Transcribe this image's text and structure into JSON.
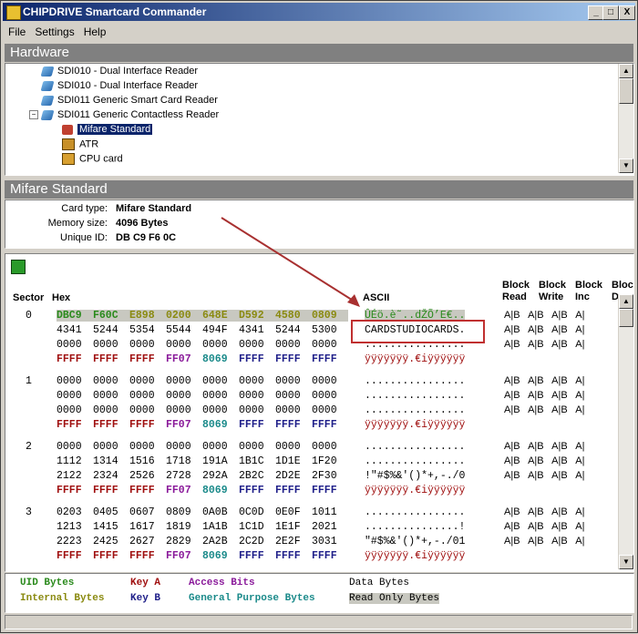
{
  "window": {
    "title": "CHIPDRIVE Smartcard Commander",
    "min": "_",
    "max": "□",
    "close": "X"
  },
  "menu": [
    "File",
    "Settings",
    "Help"
  ],
  "hardware": {
    "header": "Hardware",
    "items": [
      "SDI010 - Dual Interface Reader",
      "SDI010 - Dual Interface Reader",
      "SDI011 Generic  Smart Card Reader",
      "SDI011 Generic Contactless Reader",
      "Mifare Standard",
      "ATR",
      "CPU card"
    ]
  },
  "card": {
    "header": "Mifare Standard",
    "type_label": "Card type:",
    "type_value": "Mifare Standard",
    "mem_label": "Memory size:",
    "mem_value": "4096 Bytes",
    "uid_label": "Unique ID:",
    "uid_value": "DB C9 F6 0C"
  },
  "columns": {
    "sector": "Sector",
    "hex": "Hex",
    "ascii": "ASCII",
    "br": "Block\nRead",
    "bw": "Block\nWrite",
    "bi": "Block\nInc",
    "bd": "Block\nDec"
  },
  "sectors": [
    {
      "num": "0",
      "rows": [
        {
          "hex": [
            "DBC9",
            "F60C",
            "E898",
            "0200",
            "648E",
            "D592",
            "4580",
            "0809"
          ],
          "ascii": "ÛÉö.è˜..dŽÕ’E€..",
          "acc": "A|B   A|B   A|B   A|"
        },
        {
          "hex": [
            "4341",
            "5244",
            "5354",
            "5544",
            "494F",
            "4341",
            "5244",
            "5300"
          ],
          "ascii": "CARDSTUDIOCARDS.",
          "acc": "A|B   A|B   A|B   A|"
        },
        {
          "hex": [
            "0000",
            "0000",
            "0000",
            "0000",
            "0000",
            "0000",
            "0000",
            "0000"
          ],
          "ascii": "................",
          "acc": "A|B   A|B   A|B   A|"
        },
        {
          "hex": [
            "FFFF",
            "FFFF",
            "FFFF",
            "FF07",
            "8069",
            "FFFF",
            "FFFF",
            "FFFF"
          ],
          "ascii": "ÿÿÿÿÿÿÿ.€iÿÿÿÿÿÿ",
          "acc": ""
        }
      ]
    },
    {
      "num": "1",
      "rows": [
        {
          "hex": [
            "0000",
            "0000",
            "0000",
            "0000",
            "0000",
            "0000",
            "0000",
            "0000"
          ],
          "ascii": "................",
          "acc": "A|B   A|B   A|B   A|"
        },
        {
          "hex": [
            "0000",
            "0000",
            "0000",
            "0000",
            "0000",
            "0000",
            "0000",
            "0000"
          ],
          "ascii": "................",
          "acc": "A|B   A|B   A|B   A|"
        },
        {
          "hex": [
            "0000",
            "0000",
            "0000",
            "0000",
            "0000",
            "0000",
            "0000",
            "0000"
          ],
          "ascii": "................",
          "acc": "A|B   A|B   A|B   A|"
        },
        {
          "hex": [
            "FFFF",
            "FFFF",
            "FFFF",
            "FF07",
            "8069",
            "FFFF",
            "FFFF",
            "FFFF"
          ],
          "ascii": "ÿÿÿÿÿÿÿ.€iÿÿÿÿÿÿ",
          "acc": ""
        }
      ]
    },
    {
      "num": "2",
      "rows": [
        {
          "hex": [
            "0000",
            "0000",
            "0000",
            "0000",
            "0000",
            "0000",
            "0000",
            "0000"
          ],
          "ascii": "................",
          "acc": "A|B   A|B   A|B   A|"
        },
        {
          "hex": [
            "1112",
            "1314",
            "1516",
            "1718",
            "191A",
            "1B1C",
            "1D1E",
            "1F20"
          ],
          "ascii": "................",
          "acc": "A|B   A|B   A|B   A|"
        },
        {
          "hex": [
            "2122",
            "2324",
            "2526",
            "2728",
            "292A",
            "2B2C",
            "2D2E",
            "2F30"
          ],
          "ascii": "!\"#$%&'()*+,-./0",
          "acc": "A|B   A|B   A|B   A|"
        },
        {
          "hex": [
            "FFFF",
            "FFFF",
            "FFFF",
            "FF07",
            "8069",
            "FFFF",
            "FFFF",
            "FFFF"
          ],
          "ascii": "ÿÿÿÿÿÿÿ.€iÿÿÿÿÿÿ",
          "acc": ""
        }
      ]
    },
    {
      "num": "3",
      "rows": [
        {
          "hex": [
            "0203",
            "0405",
            "0607",
            "0809",
            "0A0B",
            "0C0D",
            "0E0F",
            "1011"
          ],
          "ascii": "................",
          "acc": "A|B   A|B   A|B   A|"
        },
        {
          "hex": [
            "1213",
            "1415",
            "1617",
            "1819",
            "1A1B",
            "1C1D",
            "1E1F",
            "2021"
          ],
          "ascii": "...............!",
          "acc": "A|B   A|B   A|B   A|"
        },
        {
          "hex": [
            "2223",
            "2425",
            "2627",
            "2829",
            "2A2B",
            "2C2D",
            "2E2F",
            "3031"
          ],
          "ascii": "\"#$%&'()*+,-./01",
          "acc": "A|B   A|B   A|B   A|"
        },
        {
          "hex": [
            "FFFF",
            "FFFF",
            "FFFF",
            "FF07",
            "8069",
            "FFFF",
            "FFFF",
            "FFFF"
          ],
          "ascii": "ÿÿÿÿÿÿÿ.€iÿÿÿÿÿÿ",
          "acc": ""
        }
      ]
    }
  ],
  "legend": {
    "uid": "UID Bytes",
    "keya": "Key A",
    "access": "Access Bits",
    "data": "Data Bytes",
    "internal": "Internal Bytes",
    "keyb": "Key B",
    "gp": "General Purpose Bytes",
    "ro": "Read Only Bytes"
  },
  "colors": {
    "uid": "#2a8a1c",
    "internal": "#8a8a10",
    "key_a": "#a01010",
    "key_b": "#20208a",
    "access": "#8a1a9a",
    "general_purpose": "#1a8a8a",
    "highlight_box": "#c03030"
  }
}
